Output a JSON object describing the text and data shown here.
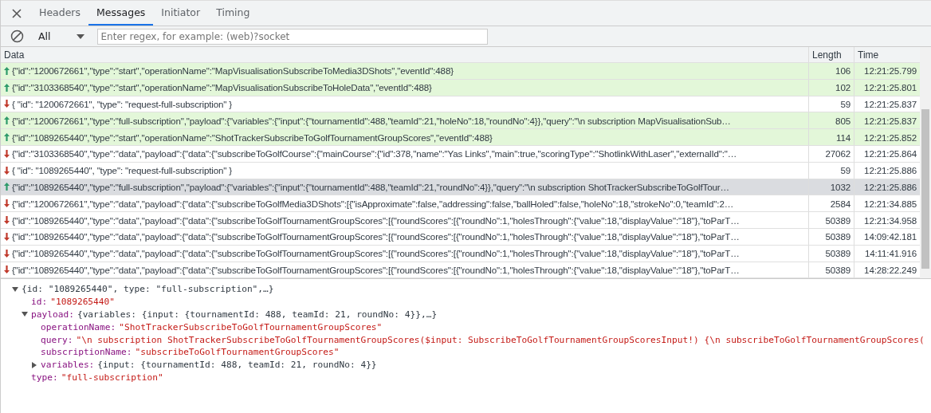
{
  "tabs": [
    {
      "label": "Headers",
      "selected": false
    },
    {
      "label": "Messages",
      "selected": true
    },
    {
      "label": "Initiator",
      "selected": false
    },
    {
      "label": "Timing",
      "selected": false
    }
  ],
  "filter": {
    "value": "All",
    "placeholder": "Enter regex, for example: (web)?socket"
  },
  "table": {
    "columns": [
      "Data",
      "Length",
      "Time"
    ],
    "rows": [
      {
        "kind": "sent",
        "selected": false,
        "data": "{\"id\":\"1200672661\",\"type\":\"start\",\"operationName\":\"MapVisualisationSubscribeToMedia3DShots\",\"eventId\":488}",
        "length": "106",
        "time": "12:21:25.799"
      },
      {
        "kind": "sent",
        "selected": false,
        "data": "{\"id\":\"3103368540\",\"type\":\"start\",\"operationName\":\"MapVisualisationSubscribeToHoleData\",\"eventId\":488}",
        "length": "102",
        "time": "12:21:25.801"
      },
      {
        "kind": "received",
        "selected": false,
        "data": "{ \"id\": \"1200672661\", \"type\": \"request-full-subscription\" }",
        "length": "59",
        "time": "12:21:25.837"
      },
      {
        "kind": "sent",
        "selected": false,
        "data": "{\"id\":\"1200672661\",\"type\":\"full-subscription\",\"payload\":{\"variables\":{\"input\":{\"tournamentId\":488,\"teamId\":21,\"holeNo\":18,\"roundNo\":4}},\"query\":\"\\n subscription MapVisualisationSub…",
        "length": "805",
        "time": "12:21:25.837"
      },
      {
        "kind": "sent",
        "selected": false,
        "data": "{\"id\":\"1089265440\",\"type\":\"start\",\"operationName\":\"ShotTrackerSubscribeToGolfTournamentGroupScores\",\"eventId\":488}",
        "length": "114",
        "time": "12:21:25.852"
      },
      {
        "kind": "received",
        "selected": false,
        "data": "{\"id\":\"3103368540\",\"type\":\"data\",\"payload\":{\"data\":{\"subscribeToGolfCourse\":{\"mainCourse\":{\"id\":378,\"name\":\"Yas Links\",\"main\":true,\"scoringType\":\"ShotlinkWithLaser\",\"externalId\":\"…",
        "length": "27062",
        "time": "12:21:25.864"
      },
      {
        "kind": "received",
        "selected": false,
        "data": "{ \"id\": \"1089265440\", \"type\": \"request-full-subscription\" }",
        "length": "59",
        "time": "12:21:25.886"
      },
      {
        "kind": "sent",
        "selected": true,
        "data": "{\"id\":\"1089265440\",\"type\":\"full-subscription\",\"payload\":{\"variables\":{\"input\":{\"tournamentId\":488,\"teamId\":21,\"roundNo\":4}},\"query\":\"\\n subscription ShotTrackerSubscribeToGolfTour…",
        "length": "1032",
        "time": "12:21:25.886"
      },
      {
        "kind": "received",
        "selected": false,
        "data": "{\"id\":\"1200672661\",\"type\":\"data\",\"payload\":{\"data\":{\"subscribeToGolfMedia3DShots\":[{\"isApproximate\":false,\"addressing\":false,\"ballHoled\":false,\"holeNo\":18,\"strokeNo\":0,\"teamId\":2…",
        "length": "2584",
        "time": "12:21:34.885"
      },
      {
        "kind": "received",
        "selected": false,
        "data": "{\"id\":\"1089265440\",\"type\":\"data\",\"payload\":{\"data\":{\"subscribeToGolfTournamentGroupScores\":[{\"roundScores\":[{\"roundNo\":1,\"holesThrough\":{\"value\":18,\"displayValue\":\"18\"},\"toParT…",
        "length": "50389",
        "time": "12:21:34.958"
      },
      {
        "kind": "received",
        "selected": false,
        "data": "{\"id\":\"1089265440\",\"type\":\"data\",\"payload\":{\"data\":{\"subscribeToGolfTournamentGroupScores\":[{\"roundScores\":[{\"roundNo\":1,\"holesThrough\":{\"value\":18,\"displayValue\":\"18\"},\"toParT…",
        "length": "50389",
        "time": "14:09:42.181"
      },
      {
        "kind": "received",
        "selected": false,
        "data": "{\"id\":\"1089265440\",\"type\":\"data\",\"payload\":{\"data\":{\"subscribeToGolfTournamentGroupScores\":[{\"roundScores\":[{\"roundNo\":1,\"holesThrough\":{\"value\":18,\"displayValue\":\"18\"},\"toParT…",
        "length": "50389",
        "time": "14:11:41.916"
      },
      {
        "kind": "received",
        "selected": false,
        "data": "{\"id\":\"1089265440\",\"type\":\"data\",\"payload\":{\"data\":{\"subscribeToGolfTournamentGroupScores\":[{\"roundScores\":[{\"roundNo\":1,\"holesThrough\":{\"value\":18,\"displayValue\":\"18\"},\"toParT…",
        "length": "50389",
        "time": "14:28:22.249"
      }
    ]
  },
  "detail": {
    "summary": "{id: \"1089265440\", type: \"full-subscription\",…}",
    "expanded": true,
    "children": [
      {
        "key": "id:",
        "kind": "string",
        "value": "\"1089265440\""
      },
      {
        "key": "payload:",
        "kind": "object",
        "value": "{variables: {input: {tournamentId: 488, teamId: 21, roundNo: 4}},…}",
        "expanded": true,
        "children": [
          {
            "key": "operationName:",
            "kind": "string",
            "value": "\"ShotTrackerSubscribeToGolfTournamentGroupScores\""
          },
          {
            "key": "query:",
            "kind": "string",
            "value": "\"\\n  subscription ShotTrackerSubscribeToGolfTournamentGroupScores($input: SubscribeToGolfTournamentGroupScoresInput!) {\\n    subscribeToGolfTournamentGroupScores("
          },
          {
            "key": "subscriptionName:",
            "kind": "string",
            "value": "\"subscribeToGolfTournamentGroupScores\""
          },
          {
            "key": "variables:",
            "kind": "object",
            "value": "{input: {tournamentId: 488, teamId: 21, roundNo: 4}}",
            "expanded": false
          }
        ]
      },
      {
        "key": "type:",
        "kind": "string",
        "value": "\"full-subscription\""
      }
    ]
  }
}
